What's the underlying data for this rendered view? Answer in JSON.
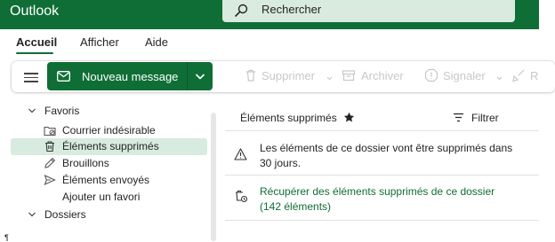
{
  "app": {
    "title": "Outlook"
  },
  "search": {
    "placeholder": "Rechercher"
  },
  "ribbon": {
    "tabs": [
      "Accueil",
      "Afficher",
      "Aide"
    ],
    "active": "Accueil"
  },
  "toolbar": {
    "new_message": "Nouveau message",
    "actions": [
      "Supprimer",
      "Archiver",
      "Signaler",
      "R"
    ]
  },
  "folders": {
    "favorites_header": "Favoris",
    "items": [
      {
        "label": "Courrier indésirable",
        "icon": "junk-folder-icon"
      },
      {
        "label": "Éléments supprimés",
        "icon": "trash-icon",
        "selected": true
      },
      {
        "label": "Brouillons",
        "icon": "pencil-icon"
      },
      {
        "label": "Éléments envoyés",
        "icon": "send-icon"
      }
    ],
    "add_favorite": "Ajouter un favori",
    "folders_header": "Dossiers"
  },
  "message_list": {
    "title": "Éléments supprimés",
    "filter_label": "Filtrer",
    "notice": "Les éléments de ce dossier vont être supprimés dans 30 jours.",
    "recover_link": "Récupérer des éléments supprimés de ce dossier (142 éléments)"
  },
  "misc": {
    "pilcrow": "¶"
  },
  "colors": {
    "brand": "#0f6e36",
    "selected": "#d7ebde",
    "search_bg": "#d9eadf"
  }
}
